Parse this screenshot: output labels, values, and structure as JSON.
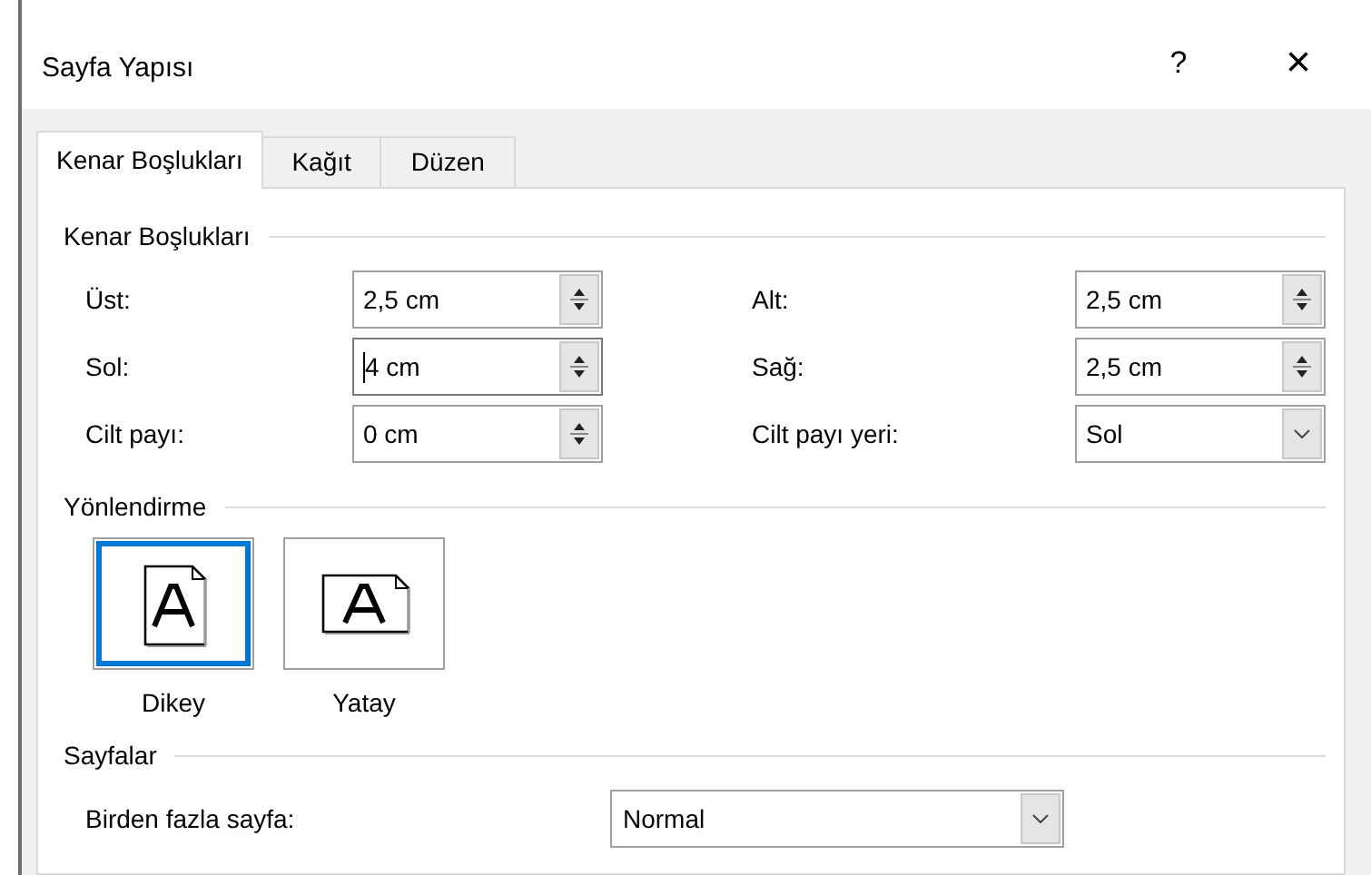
{
  "window": {
    "title": "Sayfa Yapısı",
    "help": "?",
    "close": "×"
  },
  "tabs": [
    {
      "label": "Kenar Boşlukları",
      "selected": true
    },
    {
      "label": "Kağıt",
      "selected": false
    },
    {
      "label": "Düzen",
      "selected": false
    }
  ],
  "margins": {
    "title": "Kenar Boşlukları",
    "left_fields": [
      {
        "label": "Üst:",
        "value": "2,5 cm",
        "kind": "spin",
        "focused": false
      },
      {
        "label": "Sol:",
        "value": "4 cm",
        "kind": "spin",
        "focused": true
      },
      {
        "label": "Cilt payı:",
        "value": "0 cm",
        "kind": "spin",
        "focused": false
      }
    ],
    "right_fields": [
      {
        "label": "Alt:",
        "value": "2,5 cm",
        "kind": "spin",
        "focused": false
      },
      {
        "label": "Sağ:",
        "value": "2,5 cm",
        "kind": "spin",
        "focused": false
      },
      {
        "label": "Cilt payı yeri:",
        "value": "Sol",
        "kind": "dropdown",
        "focused": false
      }
    ]
  },
  "orientation": {
    "title": "Yönlendirme",
    "options": [
      {
        "label": "Dikey",
        "kind": "portrait",
        "selected": true
      },
      {
        "label": "Yatay",
        "kind": "landscape",
        "selected": false
      }
    ]
  },
  "pages": {
    "title": "Sayfalar",
    "label": "Birden fazla sayfa:",
    "value": "Normal"
  }
}
